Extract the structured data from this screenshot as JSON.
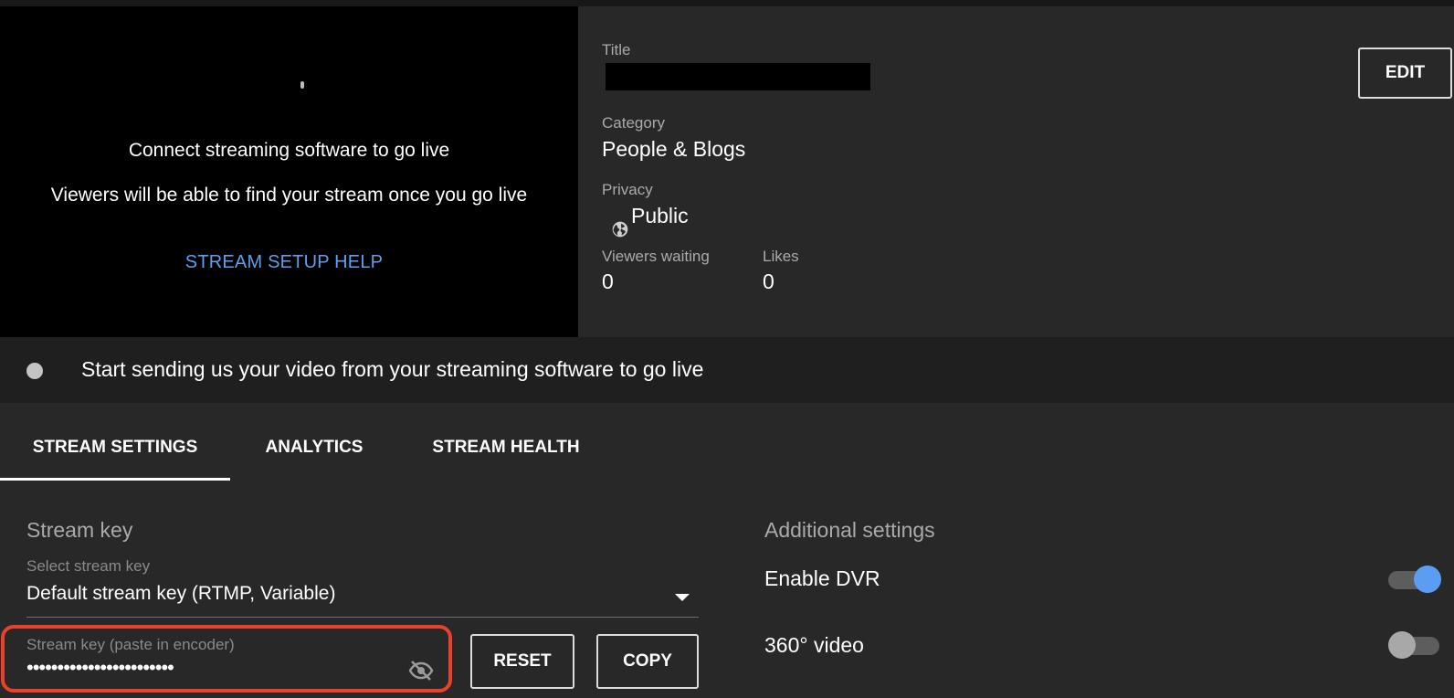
{
  "preview": {
    "message_primary": "Connect streaming software to go live",
    "message_secondary": "Viewers will be able to find your stream once you go live",
    "help_link": "STREAM SETUP HELP"
  },
  "details": {
    "title_label": "Title",
    "edit_label": "EDIT",
    "category_label": "Category",
    "category_value": "People & Blogs",
    "privacy_label": "Privacy",
    "privacy_value": "Public",
    "privacy_icon": "globe-icon",
    "viewers_label": "Viewers waiting",
    "viewers_value": "0",
    "likes_label": "Likes",
    "likes_value": "0"
  },
  "status": {
    "text": "Start sending us your video from your streaming software to go live"
  },
  "tabs": [
    {
      "label": "STREAM SETTINGS",
      "active": true
    },
    {
      "label": "ANALYTICS",
      "active": false
    },
    {
      "label": "STREAM HEALTH",
      "active": false
    }
  ],
  "stream_key": {
    "section_title": "Stream key",
    "select_label": "Select stream key",
    "select_value": "Default stream key (RTMP, Variable)",
    "key_label": "Stream key (paste in encoder)",
    "key_value": "••••••••••••••••••••••••",
    "visibility_icon": "eye-off-icon",
    "reset_label": "RESET",
    "copy_label": "COPY",
    "highlight_color": "#e8412d"
  },
  "additional": {
    "section_title": "Additional settings",
    "dvr_label": "Enable DVR",
    "dvr_enabled": true,
    "vr_label": "360° video",
    "vr_enabled": false
  },
  "colors": {
    "accent": "#5b9df3",
    "link": "#5f9fef",
    "background": "#282828"
  }
}
